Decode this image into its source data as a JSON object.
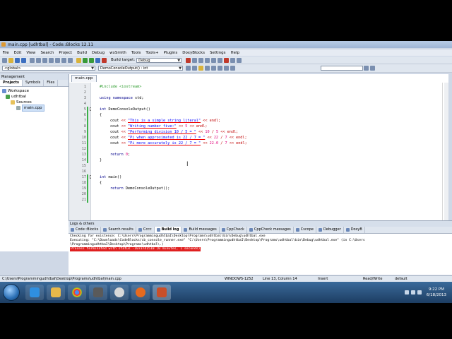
{
  "window": {
    "title": "main.cpp [udhtbal] - Code::Blocks 12.11"
  },
  "menu": [
    "File",
    "Edit",
    "View",
    "Search",
    "Project",
    "Build",
    "Debug",
    "wxSmith",
    "Tools",
    "Tools+",
    "Plugins",
    "DoxyBlocks",
    "Settings",
    "Help"
  ],
  "toolbar": {
    "build_target_label": "Build target:",
    "build_target_value": "Debug",
    "scope_value": "<global>",
    "function_value": "DemoConsoleOutput() : int"
  },
  "management": {
    "title": "Management",
    "tabs": [
      "Projects",
      "Symbols",
      "Files"
    ],
    "tree": {
      "workspace": "Workspace",
      "project": "udhtbal",
      "folder": "Sources",
      "file": "main.cpp"
    }
  },
  "editor": {
    "tab": "main.cpp",
    "line_numbers": [
      "1",
      "2",
      "3",
      "4",
      "5",
      "6",
      "7",
      "8",
      "9",
      "10",
      "11",
      "12",
      "13",
      "14",
      "15",
      "16",
      "17",
      "18",
      "19",
      "20",
      "21"
    ]
  },
  "code": {
    "l1": "#include <iostream>",
    "l3a": "using namespace",
    "l3b": "std;",
    "l5a": "int",
    "l5b": "DemoConsoleOutput()",
    "l6": "{",
    "l7a": "cout",
    "l7b": "<<",
    "l7c": "\"This is a simple string literal\"",
    "l7d": "<< endl;",
    "l8a": "cout",
    "l8b": "<<",
    "l8c": "\"Writing number five:\"",
    "l8d": "<<",
    "l8e": "5",
    "l8f": "<< endl;",
    "l9a": "cout",
    "l9b": "<<",
    "l9c": "\"Performing division 10 / 5 = \"",
    "l9d": "<<",
    "l9e": "10",
    "l9f": "/",
    "l9g": "5",
    "l9h": "<< endl;",
    "l10a": "cout",
    "l10b": "<<",
    "l10c": "\"Pi when approximated is 22 / 7 = \"",
    "l10d": "<<",
    "l10e": "22",
    "l10f": "/",
    "l10g": "7",
    "l10h": "<< endl;",
    "l11a": "cout",
    "l11b": "<<",
    "l11c": "\"Pi more accurately is 22 / 7 = \"",
    "l11d": "<<",
    "l11e": "22.0",
    "l11f": "/",
    "l11g": "7",
    "l11h": "<< endl;",
    "l13a": "return",
    "l13b": "0",
    "l13c": ";",
    "l14": "}",
    "l17a": "int",
    "l17b": "main()",
    "l18": "{",
    "l19a": "return",
    "l19b": "DemoConsoleOutput();"
  },
  "logs": {
    "title": "Logs & others",
    "tabs": [
      "Code::Blocks",
      "Search results",
      "Cccc",
      "Build log",
      "Build messages",
      "CppCheck",
      "CppCheck messages",
      "Cscope",
      "Debugger",
      "DoxyB"
    ],
    "active_tab": "Build log",
    "lines": [
      "Checking for existence: C:\\Users\\ProgrammingudhtbaI\\Desktop\\Programs\\udhtbal\\bin\\Debug\\udhtbal.exe",
      "Executing: \"C:\\Downloads\\CodeBlocks/cb_console_runner.exe\" \"C:\\Users\\ProgrammingudhtbaI\\Desktop\\Programs\\udhtbal\\bin\\Debug\\udhtbal.exe\"  (in C:\\Users",
      "\\ProgrammingudhtbaI\\Desktop\\Programs\\udhtbal\\.)"
    ],
    "error_line": "Process terminated with status -1073741510 (0 minutes, 1 seconds)"
  },
  "status": {
    "path": "C:\\Users\\ProgrammingudhtbaI\\Desktop\\Programs\\udhtbal\\main.cpp",
    "encoding": "WINDOWS-1252",
    "position": "Line 13, Column 14",
    "mode": "Insert",
    "access": "Read/Write",
    "profile": "default"
  },
  "taskbar": {
    "time": "9:22 PM",
    "date": "6/18/2013"
  }
}
